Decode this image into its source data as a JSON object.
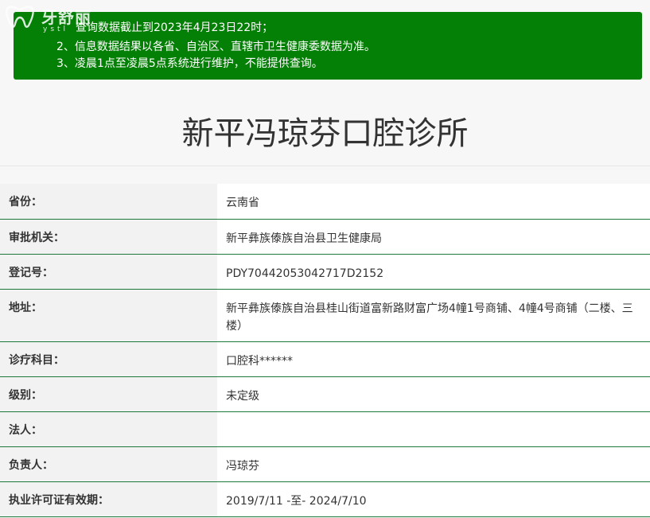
{
  "notice": {
    "line1": "查询数据截止到2023年4月23日22时；",
    "line2": "2、信息数据结果以各省、自治区、直辖市卫生健康委数据为准。",
    "line3": "3、凌晨1点至凌晨5点系统进行维护，不能提供查询。",
    "background_color": "#058006"
  },
  "watermark": {
    "text": "牙舒丽",
    "sub": "ystl"
  },
  "page": {
    "title": "新平冯琼芬口腔诊所"
  },
  "info_rows": [
    {
      "label": "省份：",
      "value": "云南省"
    },
    {
      "label": "审批机关：",
      "value": "新平彝族傣族自治县卫生健康局"
    },
    {
      "label": "登记号：",
      "value": "PDY70442053042717D2152"
    },
    {
      "label": "地址：",
      "value": "新平彝族傣族自治县桂山街道富新路财富广场4幢1号商铺、4幢4号商铺（二楼、三楼）"
    },
    {
      "label": "诊疗科目：",
      "value": "口腔科******"
    },
    {
      "label": "级别：",
      "value": "未定级"
    },
    {
      "label": "法人：",
      "value": ""
    },
    {
      "label": "负责人：",
      "value": "冯琼芬"
    },
    {
      "label": "执业许可证有效期：",
      "value": "2019/7/11 -至- 2024/7/10"
    }
  ],
  "colors": {
    "row_border": "#1d7a3a",
    "label_bg": "#f2f2f2",
    "value_bg": "#ffffff"
  }
}
